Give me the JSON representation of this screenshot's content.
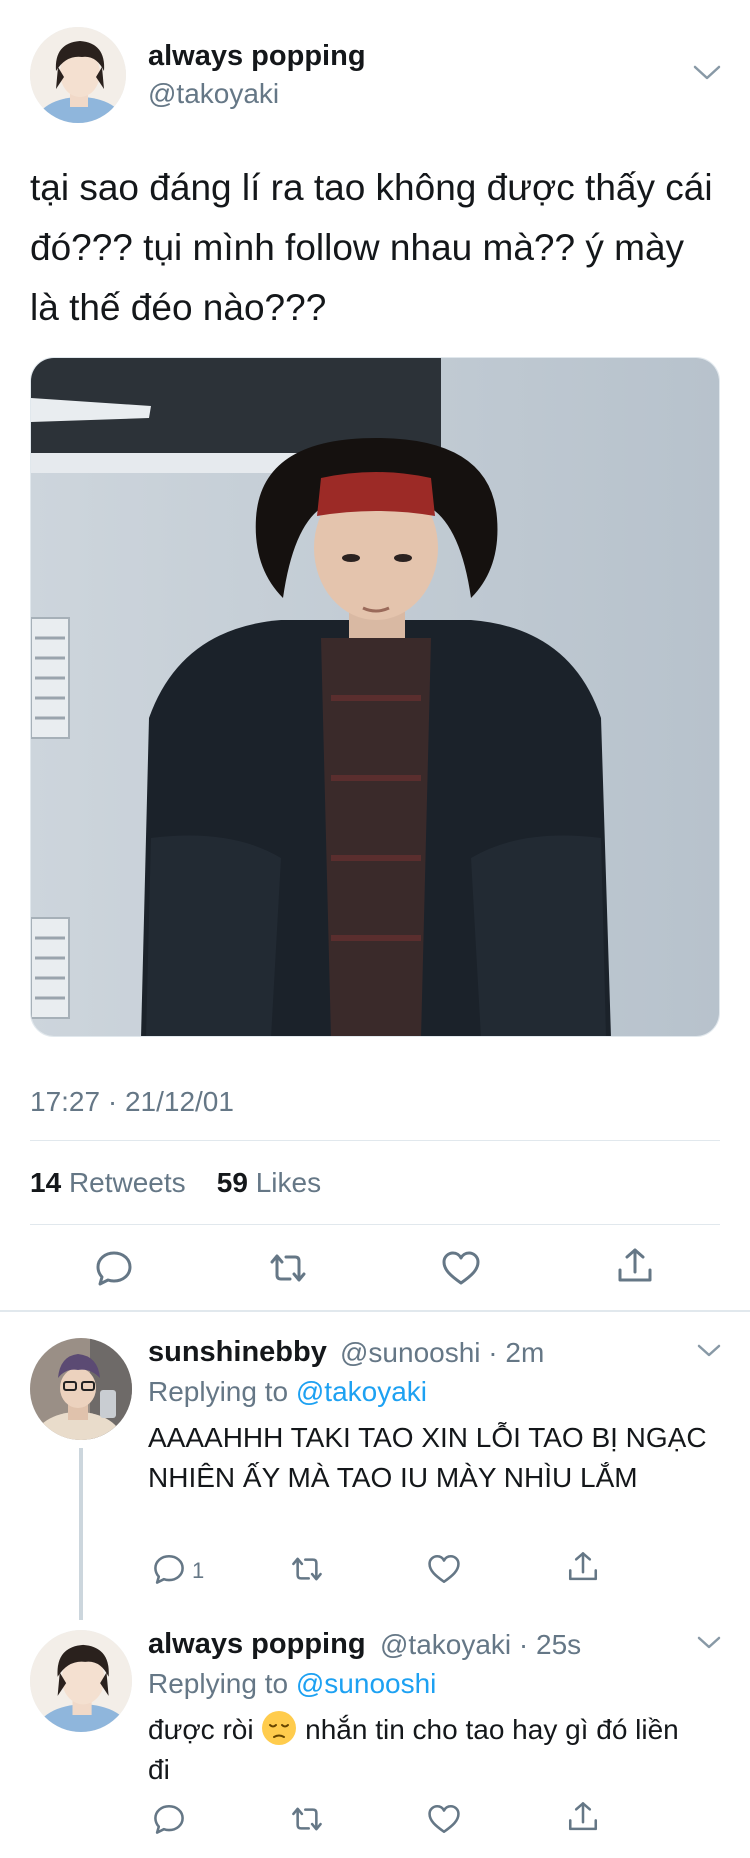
{
  "main_tweet": {
    "name": "always popping",
    "handle": "@takoyaki",
    "text": "tại sao đáng lí ra tao không được thấy cái đó??? tụi mình follow nhau mà?? ý mày là thế đéo nào???",
    "timestamp": "17:27 · 21/12/01",
    "retweets_count": "14",
    "retweets_label": "Retweets",
    "likes_count": "59",
    "likes_label": "Likes"
  },
  "replies": [
    {
      "name": "sunshinebby",
      "meta": "@sunooshi · 2m",
      "replying_prefix": "Replying to ",
      "replying_to": "@takoyaki",
      "text": "AAAAHHH TAKI TAO XIN LỖI TAO BỊ NGẠC NHIÊN ẤY MÀ TAO IU MÀY NHÌU LẮM",
      "reply_count": "1"
    },
    {
      "name": "always popping",
      "meta": "@takoyaki · 25s",
      "replying_prefix": "Replying to ",
      "replying_to": "@sunooshi",
      "text_before": "được ròi ",
      "emoji": "pensive-face",
      "text_after": " nhắn tin cho tao hay gì đó liền đi",
      "reply_count": ""
    }
  ],
  "colors": {
    "link": "#1da1f2",
    "secondary_text": "#657786",
    "divider": "#e1e8ed"
  }
}
